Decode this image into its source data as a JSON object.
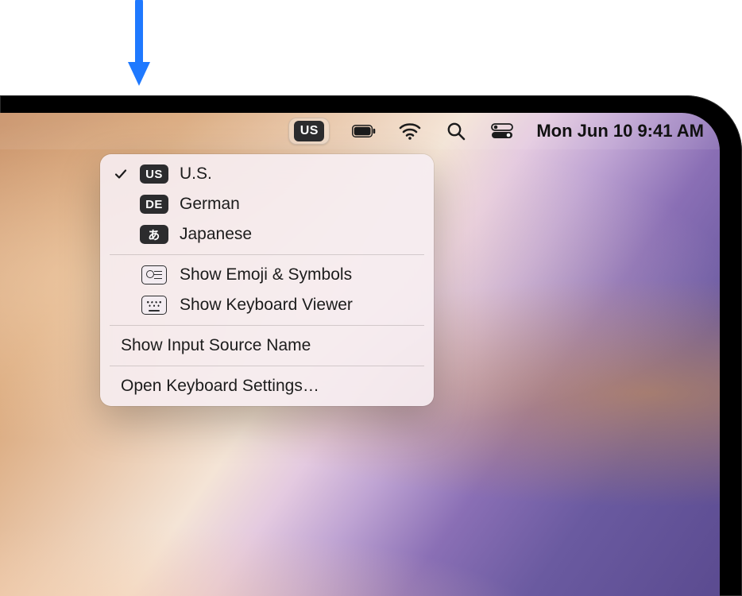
{
  "menubar": {
    "input_badge": "US",
    "datetime": "Mon Jun 10  9:41 AM"
  },
  "input_menu": {
    "sources": [
      {
        "badge": "US",
        "label": "U.S.",
        "checked": true
      },
      {
        "badge": "DE",
        "label": "German",
        "checked": false
      },
      {
        "badge": "あ",
        "label": "Japanese",
        "checked": false
      }
    ],
    "show_emoji": "Show Emoji & Symbols",
    "show_keyboard_viewer": "Show Keyboard Viewer",
    "show_input_source_name": "Show Input Source Name",
    "open_keyboard_settings": "Open Keyboard Settings…"
  }
}
